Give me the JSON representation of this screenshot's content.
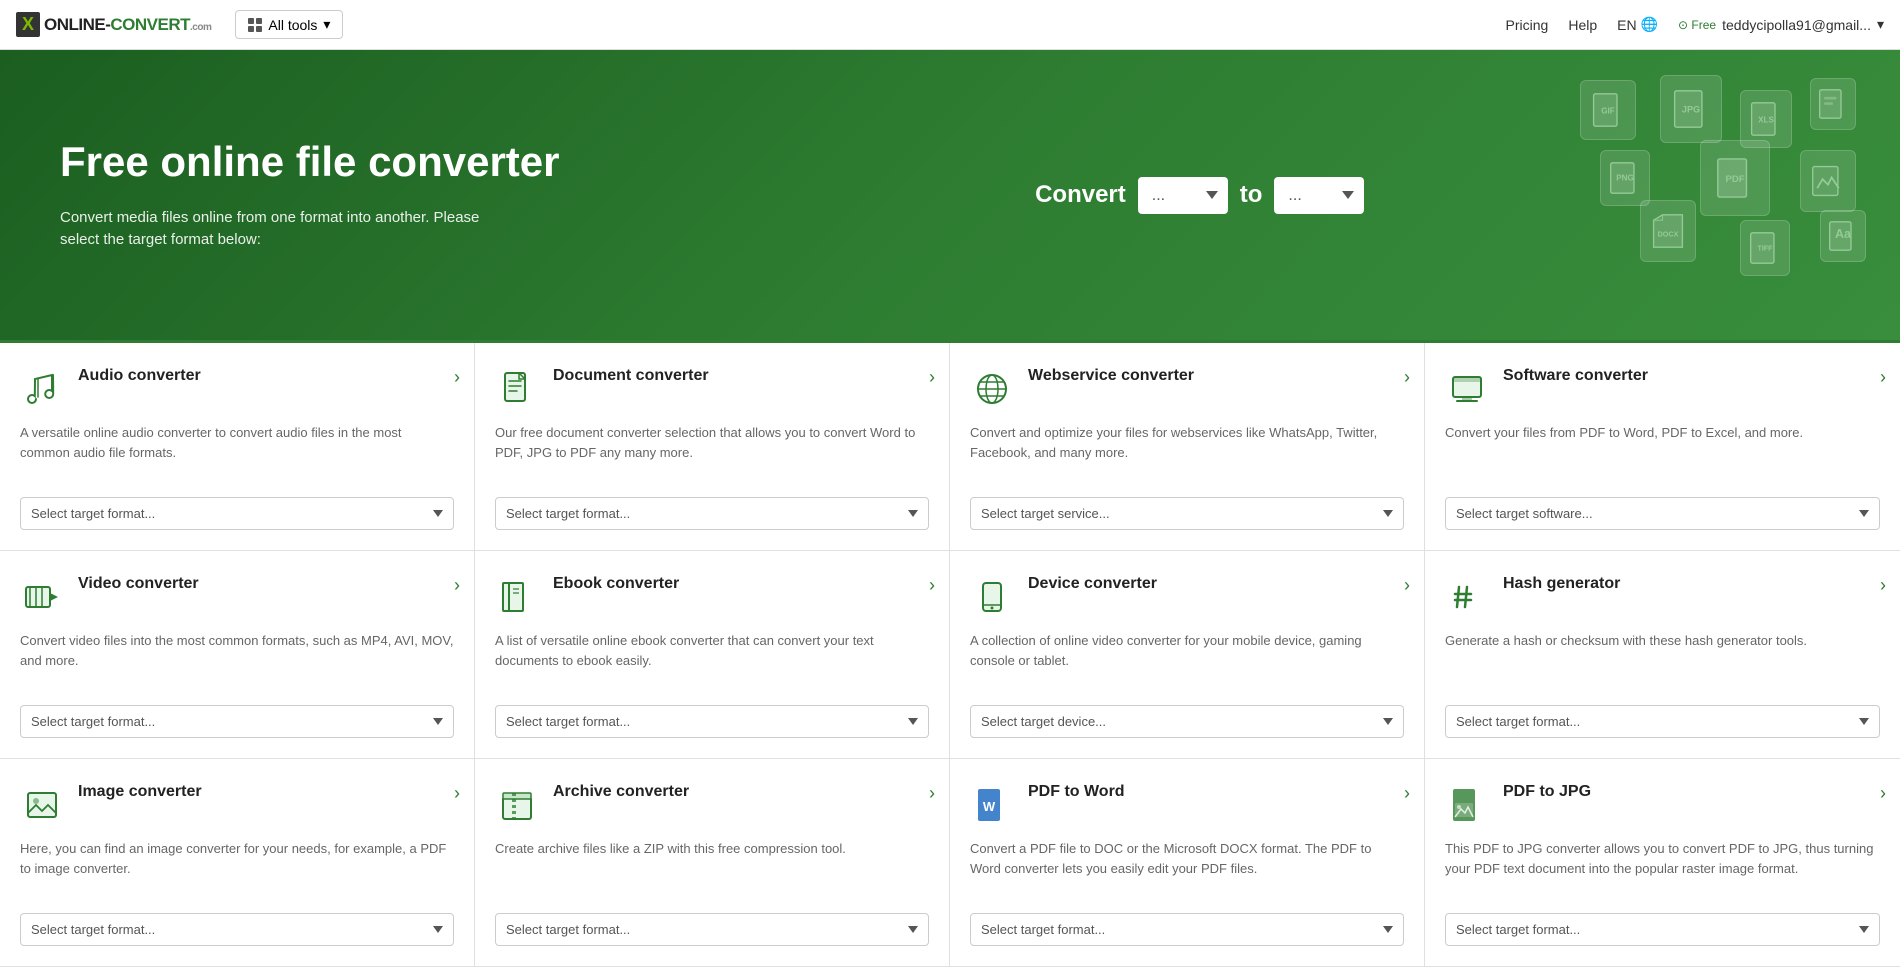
{
  "navbar": {
    "logo_box": "X",
    "logo_text": "ONLINE-CONVERT",
    "logo_com": ".com",
    "all_tools_label": "All tools",
    "pricing_label": "Pricing",
    "help_label": "Help",
    "lang_label": "EN",
    "free_label": "Free",
    "user_email": "teddycipolla91@gmail..."
  },
  "hero": {
    "title": "Free online file converter",
    "subtitle": "Convert media files online from one format into another. Please select the target format below:",
    "convert_label": "Convert",
    "to_label": "to",
    "from_placeholder": "...",
    "to_placeholder": "..."
  },
  "cards": [
    {
      "id": "audio",
      "title": "Audio converter",
      "desc": "A versatile online audio converter to convert audio files in the most common audio file formats.",
      "select_placeholder": "Select target format...",
      "icon": "audio"
    },
    {
      "id": "document",
      "title": "Document converter",
      "desc": "Our free document converter selection that allows you to convert Word to PDF, JPG to PDF any many more.",
      "select_placeholder": "Select target format...",
      "icon": "document"
    },
    {
      "id": "webservice",
      "title": "Webservice converter",
      "desc": "Convert and optimize your files for webservices like WhatsApp, Twitter, Facebook, and many more.",
      "select_placeholder": "Select target service...",
      "icon": "webservice"
    },
    {
      "id": "software",
      "title": "Software converter",
      "desc": "Convert your files from PDF to Word, PDF to Excel, and more.",
      "select_placeholder": "Select target software...",
      "icon": "software"
    },
    {
      "id": "video",
      "title": "Video converter",
      "desc": "Convert video files into the most common formats, such as MP4, AVI, MOV, and more.",
      "select_placeholder": "Select target format...",
      "icon": "video"
    },
    {
      "id": "ebook",
      "title": "Ebook converter",
      "desc": "A list of versatile online ebook converter that can convert your text documents to ebook easily.",
      "select_placeholder": "Select target format...",
      "icon": "ebook"
    },
    {
      "id": "device",
      "title": "Device converter",
      "desc": "A collection of online video converter for your mobile device, gaming console or tablet.",
      "select_placeholder": "Select target device...",
      "icon": "device"
    },
    {
      "id": "hash",
      "title": "Hash generator",
      "desc": "Generate a hash or checksum with these hash generator tools.",
      "select_placeholder": "Select target format...",
      "icon": "hash"
    },
    {
      "id": "image",
      "title": "Image converter",
      "desc": "Here, you can find an image converter for your needs, for example, a PDF to image converter.",
      "select_placeholder": "Select target format...",
      "icon": "image"
    },
    {
      "id": "archive",
      "title": "Archive converter",
      "desc": "Create archive files like a ZIP with this free compression tool.",
      "select_placeholder": "Select target format...",
      "icon": "archive"
    },
    {
      "id": "pdf-word",
      "title": "PDF to Word",
      "desc": "Convert a PDF file to DOC or the Microsoft DOCX format. The PDF to Word converter lets you easily edit your PDF files.",
      "select_placeholder": "Select target format...",
      "icon": "pdf-word"
    },
    {
      "id": "pdf-jpg",
      "title": "PDF to JPG",
      "desc": "This PDF to JPG converter allows you to convert PDF to JPG, thus turning your PDF text document into the popular raster image format.",
      "select_placeholder": "Select target format...",
      "icon": "pdf-jpg"
    }
  ]
}
